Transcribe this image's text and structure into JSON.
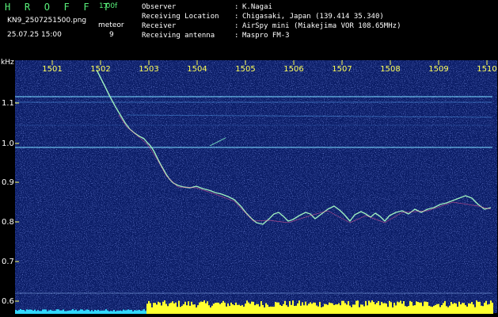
{
  "app": {
    "logo": "H R O F F T",
    "version": "1.00f",
    "filename": "KN9_2507251500.png",
    "datetime": "25.07.25 15:00",
    "meteor_label": "meteor",
    "meteor_count": "9"
  },
  "metadata": [
    {
      "label": "Observer",
      "value": "K.Nagai"
    },
    {
      "label": "Receiving Location",
      "value": "Chigasaki, Japan (139.414 35.340)"
    },
    {
      "label": "Receiver",
      "value": "AirSpy mini (Miakejima VOR 108.65MHz)"
    },
    {
      "label": "Receiving antenna",
      "value": "Maspro FM-3"
    }
  ],
  "axis": {
    "y_unit": "kHz",
    "x_ticks": [
      "1501",
      "1502",
      "1503",
      "1504",
      "1505",
      "1506",
      "1507",
      "1508",
      "1509",
      "1510"
    ],
    "y_ticks": [
      "1.1",
      "1.0",
      "0.9",
      "0.8",
      "0.7",
      "0.6"
    ]
  },
  "colors": {
    "background": "#0a1c66",
    "header_text": "#58f07a",
    "tick_text": "#ffff58",
    "trace": "#9ff0c0",
    "bottom_bar": "#ffff30",
    "bottom_bar_left": "#30d8ff"
  }
}
